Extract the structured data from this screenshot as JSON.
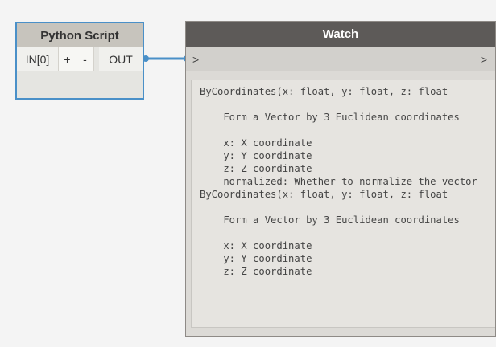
{
  "python_node": {
    "title": "Python Script",
    "in_port": "IN[0]",
    "add_label": "+",
    "remove_label": "-",
    "out_port": "OUT"
  },
  "watch_node": {
    "title": "Watch",
    "in_label": ">",
    "out_label": ">",
    "lines": [
      "ByCoordinates(x: float, y: float, z: float",
      "",
      "    Form a Vector by 3 Euclidean coordinates",
      "",
      "    x: X coordinate",
      "    y: Y coordinate",
      "    z: Z coordinate",
      "    normalized: Whether to normalize the vector",
      "ByCoordinates(x: float, y: float, z: float",
      "",
      "    Form a Vector by 3 Euclidean coordinates",
      "",
      "    x: X coordinate",
      "    y: Y coordinate",
      "    z: Z coordinate"
    ]
  },
  "colors": {
    "wire": "#4a90c8",
    "selection_border": "#4a90c8",
    "watch_header": "#5d5a58"
  }
}
